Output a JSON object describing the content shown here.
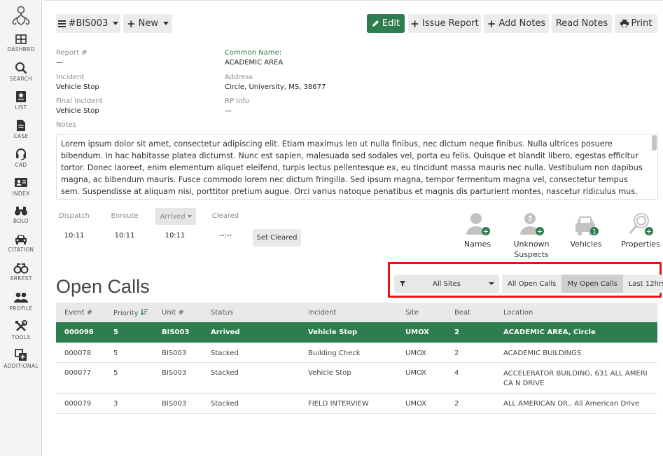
{
  "sidebar": {
    "items": [
      {
        "label": "DASHBRD",
        "icon": "dashboard-icon"
      },
      {
        "label": "SEARCH",
        "icon": "search-icon"
      },
      {
        "label": "LIST",
        "icon": "list-icon"
      },
      {
        "label": "CASE",
        "icon": "case-icon"
      },
      {
        "label": "CAD",
        "icon": "headset-icon"
      },
      {
        "label": "INDEX",
        "icon": "index-icon"
      },
      {
        "label": "BOLO",
        "icon": "binoculars-icon"
      },
      {
        "label": "CITATION",
        "icon": "car-icon"
      },
      {
        "label": "ARREST",
        "icon": "handcuffs-icon"
      },
      {
        "label": "PROFILE",
        "icon": "people-icon"
      },
      {
        "label": "TOOLS",
        "icon": "tools-icon"
      },
      {
        "label": "ADDITIONAL",
        "icon": "additional-icon"
      }
    ]
  },
  "toolbar": {
    "unit_label": "#BIS003",
    "new_label": "New",
    "edit_label": "Edit",
    "issue_report_label": "Issue Report",
    "add_notes_label": "Add Notes",
    "read_notes_label": "Read Notes",
    "print_label": "Print"
  },
  "details": {
    "report_label": "Report #",
    "report_value": "—",
    "common_name_label": "Common Name:",
    "common_name_value": "ACADEMIC AREA",
    "incident_label": "Incident",
    "incident_value": "Vehicle Stop",
    "address_label": "Address",
    "address_value": "Circle, University, MS, 38677",
    "final_incident_label": "Final Incident",
    "final_incident_value": "Vehicle Stop",
    "rp_info_label": "RP Info",
    "rp_info_value": "—",
    "notes_label": "Notes",
    "notes_text": "Lorem ipsum dolor sit amet, consectetur adipiscing elit. Etiam maximus leo ut nulla finibus, nec dictum neque finibus. Nulla ultrices posuere bibendum. In hac habitasse platea dictumst. Nunc est sapien, malesuada sed sodales vel, porta eu felis. Quisque et blandit libero, egestas efficitur tortor. Donec laoreet, enim elementum aliquet eleifend, turpis lectus pellentesque ex, eu tincidunt massa mauris nec nulla. Vestibulum non dapibus magna, ac bibendum mauris. Fusce commodo lorem nec dictum fringilla. Sed ipsum magna, tempor fermentum magna vel, consectetur tempus sem. Suspendisse at aliquam nisi, porttitor pretium augue. Orci varius natoque penatibus et magnis dis parturient montes, nascetur ridiculus mus. Cras volutpat ante facilisis, dapibus elit a,"
  },
  "times": {
    "dispatch_label": "Dispatch",
    "dispatch_value": "10:11",
    "enroute_label": "Enroute",
    "enroute_value": "10:11",
    "arrived_label": "Arrived",
    "arrived_value": "10:11",
    "cleared_label": "Cleared",
    "cleared_value": "--:--",
    "set_cleared_label": "Set Cleared"
  },
  "related": {
    "names_label": "Names",
    "names_badge": "+",
    "suspects_label": "Unknown Suspects",
    "suspects_badge": "+",
    "vehicles_label": "Vehicles",
    "vehicles_badge": "1",
    "properties_label": "Properties",
    "properties_badge": "+"
  },
  "open_calls": {
    "title": "Open Calls",
    "site_filter": "All Sites",
    "filters": [
      "All Open Calls",
      "My Open Calls",
      "Last 12hrs"
    ],
    "active_filter": "My Open Calls",
    "columns": [
      "Event #",
      "Priority",
      "Unit #",
      "Status",
      "Incident",
      "Site",
      "Beat",
      "Location"
    ],
    "rows": [
      [
        "000098",
        "5",
        "BIS003",
        "Arrived",
        "Vehicle Stop",
        "UMOX",
        "2",
        "ACADEMIC AREA, Circle"
      ],
      [
        "000078",
        "5",
        "BIS003",
        "Stacked",
        "Building Check",
        "UMOX",
        "2",
        "ACADEMIC BUILDINGS"
      ],
      [
        "000077",
        "5",
        "BIS003",
        "Stacked",
        "Vehicle Stop",
        "UMOX",
        "4",
        "ACCELERATOR BUILDING, 631 ALL AMERICA N DRIVE"
      ],
      [
        "000079",
        "3",
        "BIS003",
        "Stacked",
        "FIELD INTERVIEW",
        "UMOX",
        "2",
        "ALL AMERICAN DR., All American Drive"
      ]
    ]
  },
  "colors": {
    "accent": "#2e7d4f",
    "highlight": "#ee1111"
  }
}
